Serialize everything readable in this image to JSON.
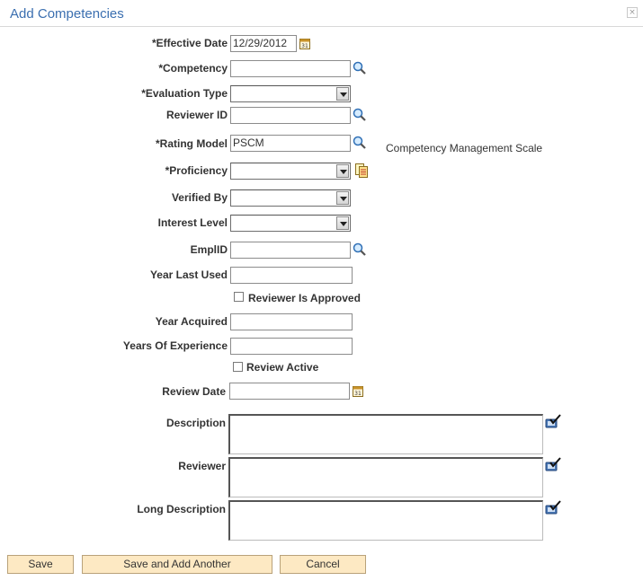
{
  "dialog": {
    "title": "Add Competencies",
    "close_symbol": "×"
  },
  "form": {
    "effective_date": {
      "label": "*Effective Date",
      "value": "12/29/2012"
    },
    "competency": {
      "label": "*Competency",
      "value": ""
    },
    "evaluation_type": {
      "label": "*Evaluation Type",
      "value": ""
    },
    "reviewer_id": {
      "label": "Reviewer ID",
      "value": ""
    },
    "rating_model": {
      "label": "*Rating Model",
      "value": "PSCM",
      "description": "Competency Management Scale"
    },
    "proficiency": {
      "label": "*Proficiency",
      "value": ""
    },
    "verified_by": {
      "label": "Verified By",
      "value": ""
    },
    "interest_level": {
      "label": "Interest Level",
      "value": ""
    },
    "emplid": {
      "label": "EmplID",
      "value": ""
    },
    "year_last_used": {
      "label": "Year Last Used",
      "value": ""
    },
    "reviewer_is_approved": {
      "label": "Reviewer Is Approved",
      "checked": false
    },
    "year_acquired": {
      "label": "Year Acquired",
      "value": ""
    },
    "years_of_experience": {
      "label": "Years Of Experience",
      "value": ""
    },
    "review_active": {
      "label": "Review Active",
      "checked": false
    },
    "review_date": {
      "label": "Review Date",
      "value": ""
    },
    "description": {
      "label": "Description",
      "value": ""
    },
    "reviewer": {
      "label": "Reviewer",
      "value": ""
    },
    "long_description": {
      "label": "Long Description",
      "value": ""
    }
  },
  "buttons": {
    "save": "Save",
    "save_and_add_another": "Save and Add Another",
    "cancel": "Cancel"
  },
  "icons": {
    "lookup": "magnifier-icon",
    "calendar": "calendar-icon",
    "prompt_list": "prompt-list-icon",
    "spell_check": "spell-check-icon"
  },
  "colors": {
    "title": "#3b6fb0",
    "button_bg": "#fde9c3",
    "button_border": "#b9a27a"
  }
}
